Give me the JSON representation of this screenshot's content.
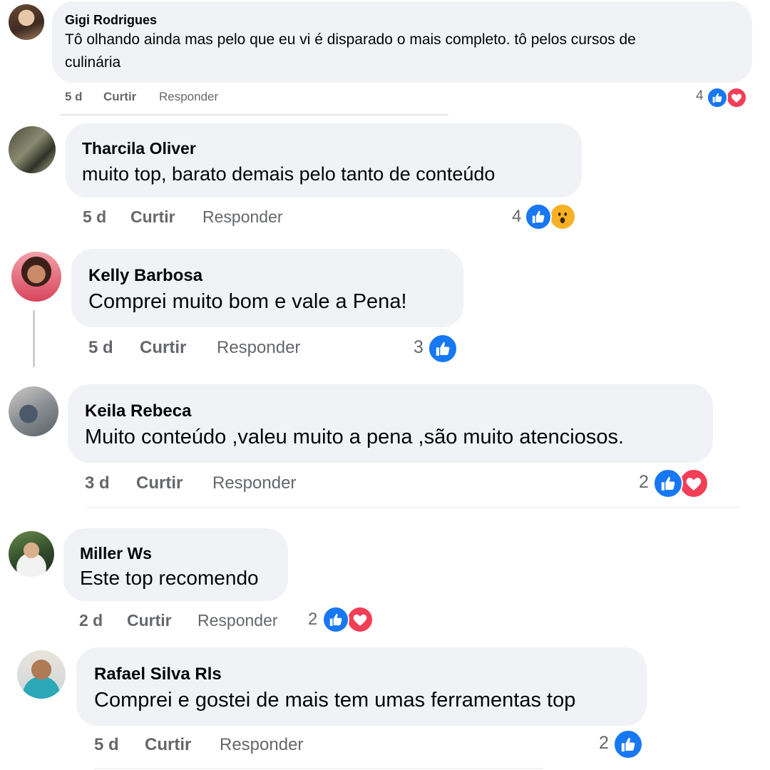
{
  "comments": [
    {
      "name": "Gigi Rodrigues",
      "text_line1": "Tô olhando ainda mas pelo que eu vi é disparado o mais completo. tô pelos cursos de",
      "text_line2": "culinária",
      "time": "5 d",
      "like_label": "Curtir",
      "reply_label": "Responder",
      "reaction_count": "4",
      "reactions": [
        "like-icon",
        "love-icon"
      ]
    },
    {
      "name": "Tharcila Oliver",
      "text": "muito top, barato demais pelo tanto de conteúdo",
      "time": "5 d",
      "like_label": "Curtir",
      "reply_label": "Responder",
      "reaction_count": "4",
      "reactions": [
        "like-icon",
        "wow-icon"
      ]
    },
    {
      "name": "Kelly Barbosa",
      "text": "Comprei muito bom e vale a Pena!",
      "time": "5 d",
      "like_label": "Curtir",
      "reply_label": "Responder",
      "reaction_count": "3",
      "reactions": [
        "like-icon"
      ]
    },
    {
      "name": "Keila Rebeca",
      "text": "Muito conteúdo ,valeu muito a pena ,são muito atenciosos.",
      "time": "3 d",
      "like_label": "Curtir",
      "reply_label": "Responder",
      "reaction_count": "2",
      "reactions": [
        "like-icon",
        "love-icon"
      ]
    },
    {
      "name": "Miller Ws",
      "text": "Este top recomendo",
      "time": "2 d",
      "like_label": "Curtir",
      "reply_label": "Responder",
      "reaction_count": "2",
      "reactions": [
        "like-icon",
        "love-icon"
      ]
    },
    {
      "name": "Rafael Silva Rls",
      "text": "Comprei e gostei de mais tem umas ferramentas top",
      "time": "5 d",
      "like_label": "Curtir",
      "reply_label": "Responder",
      "reaction_count": "2",
      "reactions": [
        "like-icon"
      ]
    }
  ],
  "colors": {
    "bubble": "#f0f2f5",
    "meta": "#65676b",
    "like": "#1877f2",
    "love": "#f33e58",
    "wow": "#f7b125"
  }
}
